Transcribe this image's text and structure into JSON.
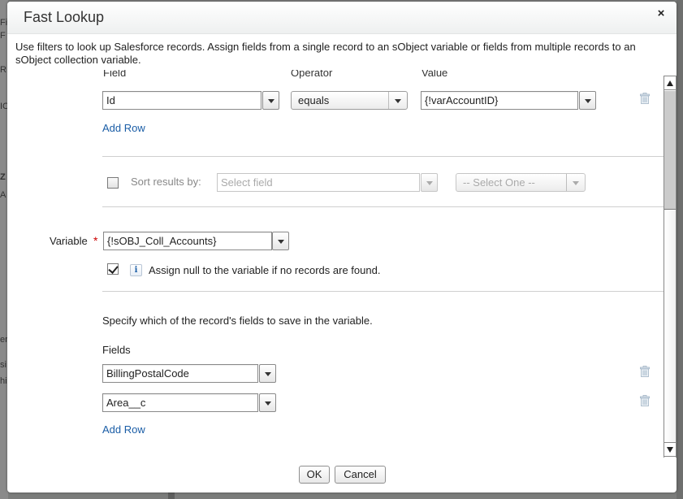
{
  "background": {
    "left_labels": [
      "Fi",
      "F",
      "R",
      "IC",
      "Z",
      "A",
      "eri",
      "si",
      "hi"
    ]
  },
  "dialog": {
    "title": "Fast Lookup",
    "close_label": "×",
    "description": "Use filters to look up Salesforce records. Assign fields from a single record to an sObject variable or fields from multiple records to an sObject collection variable."
  },
  "filters": {
    "headers": {
      "field": "Field",
      "operator": "Operator",
      "value": "Value"
    },
    "rows": [
      {
        "field": "Id",
        "operator": "equals",
        "value": "{!varAccountID}"
      }
    ],
    "add_row_label": "Add Row"
  },
  "sort": {
    "checked": false,
    "label": "Sort results by:",
    "field_placeholder": "Select field",
    "order_placeholder": "-- Select One --"
  },
  "variable": {
    "label": "Variable",
    "required_mark": "*",
    "value": "{!sOBJ_Coll_Accounts}",
    "assign_null_checked": true,
    "info_icon_glyph": "i",
    "assign_null_label": "Assign null to the variable if no records are found."
  },
  "fields_section": {
    "instruction": "Specify which of the record's fields to save in the variable.",
    "label": "Fields",
    "rows": [
      "BillingPostalCode",
      "Area__c"
    ],
    "add_row_label": "Add Row"
  },
  "footer": {
    "ok_label": "OK",
    "cancel_label": "Cancel"
  },
  "colors": {
    "link": "#1a5da6",
    "required": "#cc0000",
    "overlay": "#7b7c7b"
  }
}
